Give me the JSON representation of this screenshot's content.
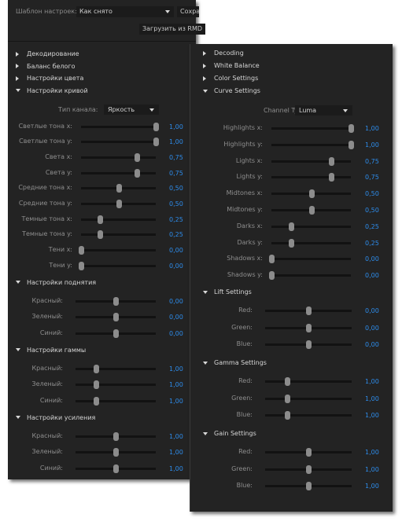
{
  "panel_ru": {
    "template_label": "Шаблон настроек:",
    "template_value": "Как снято",
    "save_button": "Сохра",
    "load_button": "Загрузить из RMD",
    "sections_collapsed": [
      "Декодирование",
      "Баланс белого",
      "Настройки цвета"
    ],
    "curve_section": "Настройки кривой",
    "channel_label": "Тип канала:",
    "channel_value": "Яркость",
    "curve_sliders": [
      {
        "label": "Светлые тона x:",
        "value": "1,00",
        "pos": 1.0
      },
      {
        "label": "Светлые тона y:",
        "value": "1,00",
        "pos": 1.0
      },
      {
        "label": "Света x:",
        "value": "0,75",
        "pos": 0.75
      },
      {
        "label": "Света y:",
        "value": "0,75",
        "pos": 0.75
      },
      {
        "label": "Средние тона x:",
        "value": "0,50",
        "pos": 0.5
      },
      {
        "label": "Средние тона y:",
        "value": "0,50",
        "pos": 0.5
      },
      {
        "label": "Темные тона x:",
        "value": "0,25",
        "pos": 0.25
      },
      {
        "label": "Темные тона y:",
        "value": "0,25",
        "pos": 0.25
      },
      {
        "label": "Тени x:",
        "value": "0,00",
        "pos": 0.0
      },
      {
        "label": "Тени y:",
        "value": "0,00",
        "pos": 0.0
      }
    ],
    "groups": [
      {
        "title": "Настройки поднятия",
        "sliders": [
          {
            "label": "Красный:",
            "value": "0,00",
            "pos": 0.5
          },
          {
            "label": "Зеленый:",
            "value": "0,00",
            "pos": 0.5
          },
          {
            "label": "Синий:",
            "value": "0,00",
            "pos": 0.5
          }
        ]
      },
      {
        "title": "Настройки гаммы",
        "sliders": [
          {
            "label": "Красный:",
            "value": "1,00",
            "pos": 0.25
          },
          {
            "label": "Зеленый:",
            "value": "1,00",
            "pos": 0.25
          },
          {
            "label": "Синий:",
            "value": "1,00",
            "pos": 0.25
          }
        ]
      },
      {
        "title": "Настройки усиления",
        "sliders": [
          {
            "label": "Красный:",
            "value": "1,00",
            "pos": 0.5
          },
          {
            "label": "Зеленый:",
            "value": "1,00",
            "pos": 0.5
          },
          {
            "label": "Синий:",
            "value": "1,00",
            "pos": 0.5
          }
        ]
      }
    ]
  },
  "panel_en": {
    "sections_collapsed": [
      "Decoding",
      "White Balance",
      "Color Settings"
    ],
    "curve_section": "Curve Settings",
    "channel_label": "Channel Type:",
    "channel_value": "Luma",
    "curve_sliders": [
      {
        "label": "Highlights x:",
        "value": "1,00",
        "pos": 1.0
      },
      {
        "label": "Highlights y:",
        "value": "1,00",
        "pos": 1.0
      },
      {
        "label": "Lights x:",
        "value": "0,75",
        "pos": 0.75
      },
      {
        "label": "Lights y:",
        "value": "0,75",
        "pos": 0.75
      },
      {
        "label": "Midtones x:",
        "value": "0,50",
        "pos": 0.5
      },
      {
        "label": "Midtones y:",
        "value": "0,50",
        "pos": 0.5
      },
      {
        "label": "Darks x:",
        "value": "0,25",
        "pos": 0.25
      },
      {
        "label": "Darks y:",
        "value": "0,25",
        "pos": 0.25
      },
      {
        "label": "Shadows x:",
        "value": "0,00",
        "pos": 0.0
      },
      {
        "label": "Shadows y:",
        "value": "0,00",
        "pos": 0.0
      }
    ],
    "groups": [
      {
        "title": "Lift Settings",
        "sliders": [
          {
            "label": "Red:",
            "value": "0,00",
            "pos": 0.5
          },
          {
            "label": "Green:",
            "value": "0,00",
            "pos": 0.5
          },
          {
            "label": "Blue:",
            "value": "0,00",
            "pos": 0.5
          }
        ]
      },
      {
        "title": "Gamma Settings",
        "sliders": [
          {
            "label": "Red:",
            "value": "1,00",
            "pos": 0.25
          },
          {
            "label": "Green:",
            "value": "1,00",
            "pos": 0.25
          },
          {
            "label": "Blue:",
            "value": "1,00",
            "pos": 0.25
          }
        ]
      },
      {
        "title": "Gain Settings",
        "sliders": [
          {
            "label": "Red:",
            "value": "1,00",
            "pos": 0.5
          },
          {
            "label": "Green:",
            "value": "1,00",
            "pos": 0.5
          },
          {
            "label": "Blue:",
            "value": "1,00",
            "pos": 0.5
          }
        ]
      }
    ]
  },
  "colors": {
    "value_text": "#2d8ceb",
    "panel_bg": "#232323",
    "track": "#121212",
    "thumb": "#8c8c8c"
  }
}
